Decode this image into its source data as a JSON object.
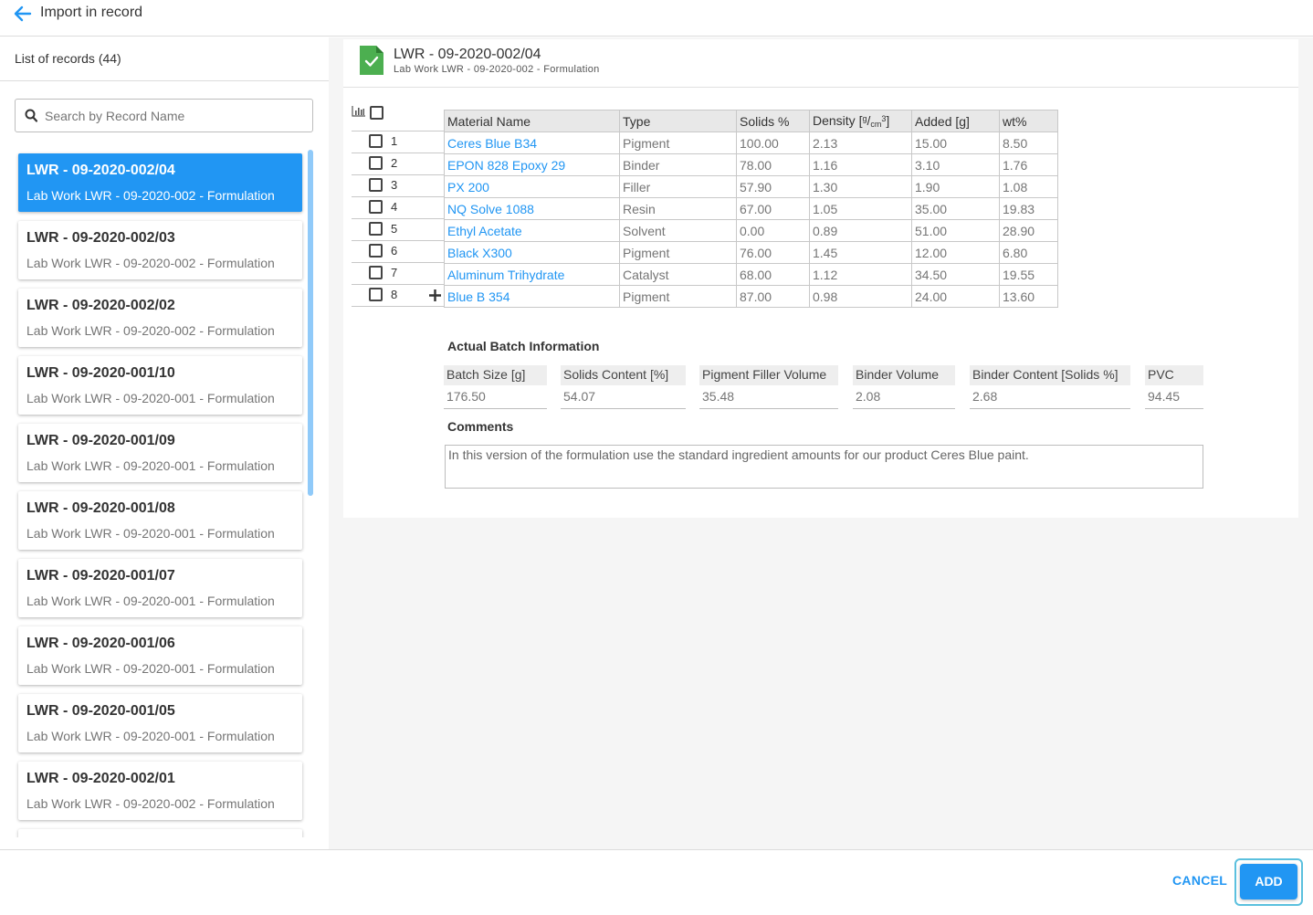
{
  "header": {
    "title": "Import in record"
  },
  "sidebar": {
    "list_title": "List of records (44)",
    "search_placeholder": "Search by Record Name",
    "records": [
      {
        "name": "LWR - 09-2020-002/04",
        "subtitle": "Lab Work LWR - 09-2020-002 - Formulation",
        "selected": true
      },
      {
        "name": "LWR - 09-2020-002/03",
        "subtitle": "Lab Work LWR - 09-2020-002 - Formulation"
      },
      {
        "name": "LWR - 09-2020-002/02",
        "subtitle": "Lab Work LWR - 09-2020-002 - Formulation"
      },
      {
        "name": "LWR - 09-2020-001/10",
        "subtitle": "Lab Work LWR - 09-2020-001 - Formulation"
      },
      {
        "name": "LWR - 09-2020-001/09",
        "subtitle": "Lab Work LWR - 09-2020-001 - Formulation"
      },
      {
        "name": "LWR - 09-2020-001/08",
        "subtitle": "Lab Work LWR - 09-2020-001 - Formulation"
      },
      {
        "name": "LWR - 09-2020-001/07",
        "subtitle": "Lab Work LWR - 09-2020-001 - Formulation"
      },
      {
        "name": "LWR - 09-2020-001/06",
        "subtitle": "Lab Work LWR - 09-2020-001 - Formulation"
      },
      {
        "name": "LWR - 09-2020-001/05",
        "subtitle": "Lab Work LWR - 09-2020-001 - Formulation"
      },
      {
        "name": "LWR - 09-2020-002/01",
        "subtitle": "Lab Work LWR - 09-2020-002 - Formulation"
      }
    ]
  },
  "detail": {
    "title": "LWR - 09-2020-002/04",
    "subtitle": "Lab Work LWR - 09-2020-002 - Formulation",
    "table": {
      "headers": {
        "material": "Material Name",
        "type": "Type",
        "solids": "Solids %",
        "density": "Density [",
        "density_num": "g",
        "density_sep": "/",
        "density_den": "cm",
        "density_exp": "3",
        "density_close": "]",
        "added": "Added [g]",
        "wt": "wt%"
      },
      "rows": [
        {
          "num": "1",
          "material": "Ceres Blue B34",
          "type": "Pigment",
          "solids": "100.00",
          "density": "2.13",
          "added": "15.00",
          "wt": "8.50"
        },
        {
          "num": "2",
          "material": "EPON 828 Epoxy 29",
          "type": "Binder",
          "solids": "78.00",
          "density": "1.16",
          "added": "3.10",
          "wt": "1.76"
        },
        {
          "num": "3",
          "material": "PX 200",
          "type": "Filler",
          "solids": "57.90",
          "density": "1.30",
          "added": "1.90",
          "wt": "1.08"
        },
        {
          "num": "4",
          "material": "NQ Solve 1088",
          "type": "Resin",
          "solids": "67.00",
          "density": "1.05",
          "added": "35.00",
          "wt": "19.83"
        },
        {
          "num": "5",
          "material": "Ethyl Acetate",
          "type": "Solvent",
          "solids": "0.00",
          "density": "0.89",
          "added": "51.00",
          "wt": "28.90"
        },
        {
          "num": "6",
          "material": "Black X300",
          "type": "Pigment",
          "solids": "76.00",
          "density": "1.45",
          "added": "12.00",
          "wt": "6.80"
        },
        {
          "num": "7",
          "material": "Aluminum Trihydrate",
          "type": "Catalyst",
          "solids": "68.00",
          "density": "1.12",
          "added": "34.50",
          "wt": "19.55"
        },
        {
          "num": "8",
          "material": "Blue B 354",
          "type": "Pigment",
          "solids": "87.00",
          "density": "0.98",
          "added": "24.00",
          "wt": "13.60"
        }
      ]
    },
    "batch": {
      "title": "Actual Batch Information",
      "fields": [
        {
          "label": "Batch Size [g]",
          "value": "176.50"
        },
        {
          "label": "Solids Content [%]",
          "value": "54.07"
        },
        {
          "label": "Pigment Filler Volume",
          "value": "35.48"
        },
        {
          "label": "Binder Volume",
          "value": "2.08"
        },
        {
          "label": "Binder Content [Solids %]",
          "value": "2.68"
        },
        {
          "label": "PVC",
          "value": "94.45"
        }
      ]
    },
    "comments": {
      "title": "Comments",
      "text": "In this version of the formulation use the standard ingredient amounts for our product Ceres Blue paint."
    }
  },
  "footer": {
    "cancel_label": "CANCEL",
    "add_label": "ADD"
  },
  "colors": {
    "accent": "#2196f3",
    "doc_icon": "#4caf50",
    "focus_ring": "#5bc0de"
  },
  "icons": [
    "back-arrow-icon",
    "search-icon",
    "document-check-icon",
    "chart-icon",
    "plus-icon"
  ]
}
